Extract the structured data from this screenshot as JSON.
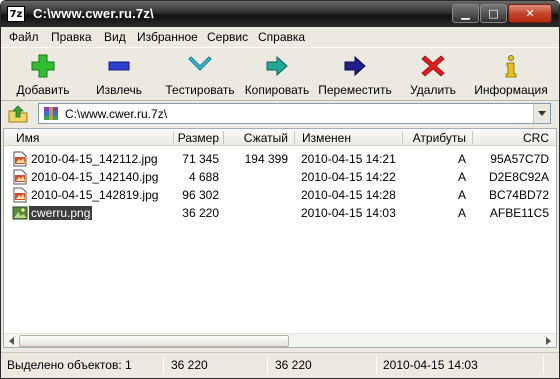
{
  "window": {
    "icon_text": "7z",
    "title": "C:\\www.cwer.ru.7z\\"
  },
  "menu": [
    "Файл",
    "Правка",
    "Вид",
    "Избранное",
    "Сервис",
    "Справка"
  ],
  "toolbar": {
    "add": "Добавить",
    "extract": "Извлечь",
    "test": "Тестировать",
    "copy": "Копировать",
    "move": "Переместить",
    "delete": "Удалить",
    "info": "Информация"
  },
  "address": {
    "path": "C:\\www.cwer.ru.7z\\"
  },
  "columns": {
    "name": "Имя",
    "size": "Размер",
    "packed": "Сжатый",
    "modified": "Изменен",
    "attributes": "Атрибуты",
    "crc": "CRC"
  },
  "files": [
    {
      "name": "2010-04-15_142112.jpg",
      "size": "71 345",
      "packed": "194 399",
      "modified": "2010-04-15 14:21",
      "attr": "A",
      "crc": "95A57C7D",
      "icon": "jpg-file-icon"
    },
    {
      "name": "2010-04-15_142140.jpg",
      "size": "4 688",
      "packed": "",
      "modified": "2010-04-15 14:22",
      "attr": "A",
      "crc": "D2E8C92A",
      "icon": "jpg-file-icon"
    },
    {
      "name": "2010-04-15_142819.jpg",
      "size": "96 302",
      "packed": "",
      "modified": "2010-04-15 14:28",
      "attr": "A",
      "crc": "BC74BD72",
      "icon": "jpg-file-icon"
    },
    {
      "name": "cwerru.png",
      "size": "36 220",
      "packed": "",
      "modified": "2010-04-15 14:03",
      "attr": "A",
      "crc": "AFBE11C5",
      "icon": "png-file-icon",
      "selected": true
    }
  ],
  "status": {
    "selected": "Выделено объектов: 1",
    "size": "36 220",
    "packed": "36 220",
    "modified": "2010-04-15 14:03"
  }
}
